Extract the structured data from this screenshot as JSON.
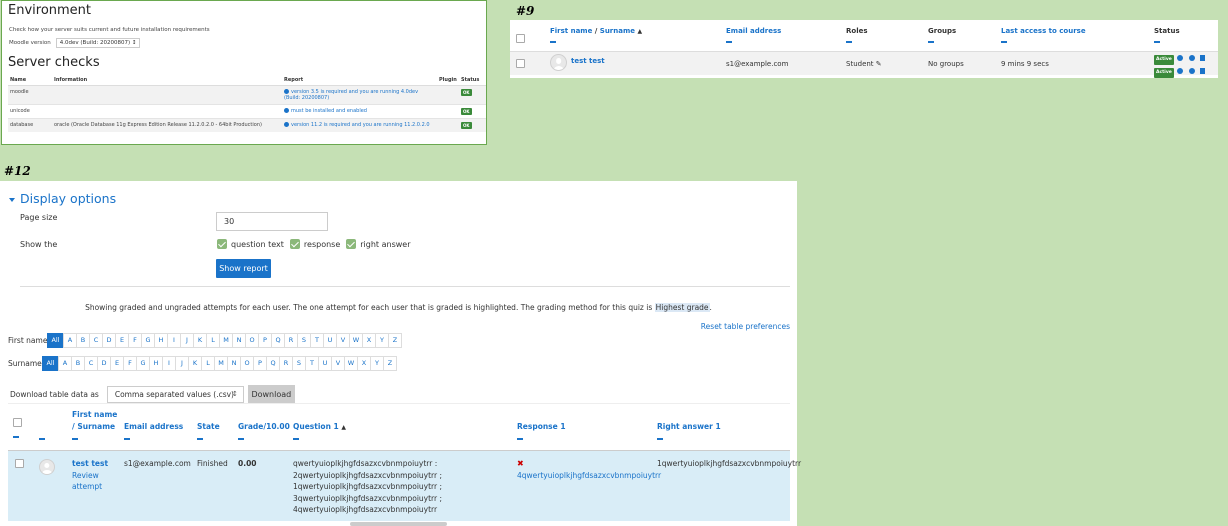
{
  "env": {
    "title": "Environment",
    "hint": "Check how your server suits current and future installation requirements",
    "version_label": "Moodle version",
    "version_value": "4.0dev (Build: 20200807)",
    "checks_title": "Server checks",
    "columns": [
      "Name",
      "Information",
      "Report",
      "Plugin",
      "Status"
    ],
    "rows": [
      {
        "name": "moodle",
        "info": "",
        "report": "version 3.5 is required and you are running 4.0dev (Build: 20200807)",
        "plugin": "",
        "status": "OK"
      },
      {
        "name": "unicode",
        "info": "",
        "report": "must be installed and enabled",
        "plugin": "",
        "status": "OK"
      },
      {
        "name": "database",
        "info": "oracle (Oracle Database 11g Express Edition Release 11.2.0.2.0 - 64bit Production)",
        "report": "version 11.2 is required and you are running 11.2.0.2.0",
        "plugin": "",
        "status": "OK"
      }
    ]
  },
  "label9": "#9",
  "participants": {
    "headers": {
      "firstname": "First name",
      "sep": "/",
      "surname": "Surname",
      "email": "Email address",
      "roles": "Roles",
      "groups": "Groups",
      "last_access": "Last access to course",
      "status": "Status"
    },
    "row": {
      "name": "test test",
      "email": "s1@example.com",
      "role": "Student",
      "groups": "No groups",
      "last_access": "9 mins 9 secs",
      "status1": "Active",
      "status2": "Active"
    }
  },
  "label12": "#12",
  "report": {
    "display_options": "Display options",
    "page_size_label": "Page size",
    "page_size_value": "30",
    "show_the_label": "Show the",
    "options": [
      "question text",
      "response",
      "right answer"
    ],
    "show_report_button": "Show report",
    "notice_prefix": "Showing graded and ungraded attempts for each user. The one attempt for each user that is graded is highlighted. The grading method for this quiz is ",
    "notice_highlight": "Highest grade",
    "notice_suffix": ".",
    "reset_link": "Reset table preferences",
    "firstname_label": "First name",
    "surname_label": "Surname",
    "all": "All",
    "letters": [
      "A",
      "B",
      "C",
      "D",
      "E",
      "F",
      "G",
      "H",
      "I",
      "J",
      "K",
      "L",
      "M",
      "N",
      "O",
      "P",
      "Q",
      "R",
      "S",
      "T",
      "U",
      "V",
      "W",
      "X",
      "Y",
      "Z"
    ],
    "download_label": "Download table data as",
    "download_format": "Comma separated values (.csv)",
    "download_button": "Download",
    "columns": {
      "name_line1": "First name",
      "name_line2": "/ Surname",
      "email": "Email address",
      "state": "State",
      "grade": "Grade/10.00",
      "question": "Question 1",
      "response": "Response 1",
      "right_answer": "Right answer 1"
    },
    "row": {
      "name": "test test",
      "review": "Review",
      "attempt": "attempt",
      "email": "s1@example.com",
      "state": "Finished",
      "grade": "0.00",
      "question_lines": [
        "qwertyuioplkjhgfdsazxcvbnmpoiuytrr :",
        "2qwertyuioplkjhgfdsazxcvbnmpoiuytrr ;",
        "1qwertyuioplkjhgfdsazxcvbnmpoiuytrr ;",
        "3qwertyuioplkjhgfdsazxcvbnmpoiuytrr ;",
        "4qwertyuioplkjhgfdsazxcvbnmpoiuytrr"
      ],
      "response": "4qwertyuioplkjhgfdsazxcvbnmpoiuytrr",
      "right_answer": "1qwertyuioplkjhgfdsazxcvbnmpoiuytrr"
    }
  }
}
